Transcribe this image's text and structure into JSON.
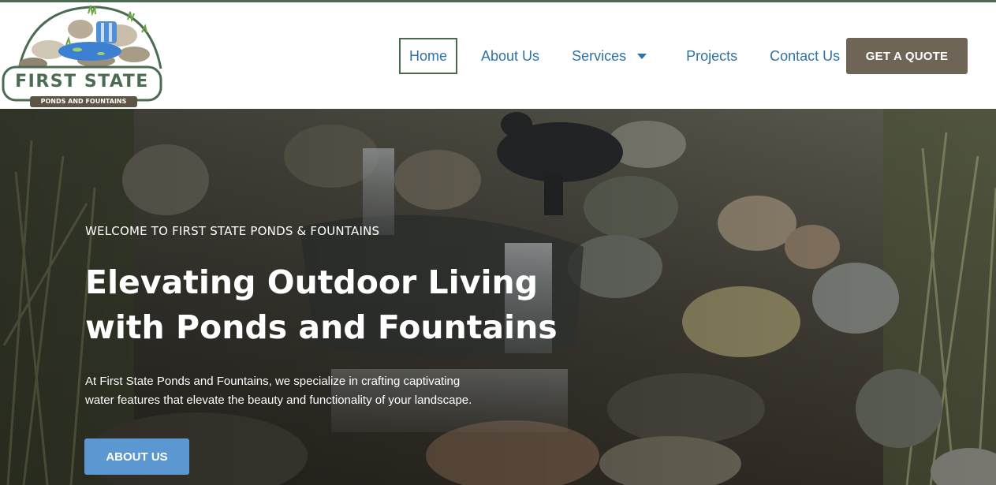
{
  "brand": {
    "title": "FIRST STATE",
    "subtitle": "PONDS AND FOUNTAINS"
  },
  "nav": {
    "items": [
      {
        "label": "Home",
        "active": true
      },
      {
        "label": "About Us"
      },
      {
        "label": "Services",
        "has_dropdown": true
      },
      {
        "label": "Projects"
      },
      {
        "label": "Contact Us"
      }
    ],
    "cta_label": "GET A QUOTE"
  },
  "hero": {
    "eyebrow": "WELCOME TO FIRST STATE PONDS & FOUNTAINS",
    "headline_line1": "Elevating Outdoor Living",
    "headline_line2": "with Ponds and Fountains",
    "description_line1": "At First State Ponds and Fountains, we specialize in crafting captivating",
    "description_line2": "water features that elevate the beauty and functionality of your landscape.",
    "button_label": "ABOUT US"
  },
  "colors": {
    "brand_green": "#4a6a52",
    "link_blue": "#2f72a8",
    "quote_button": "#6e6556",
    "about_button": "#5b97d1"
  },
  "icons": {
    "dropdown": "chevron-down-icon",
    "logo": "pond-logo-icon"
  }
}
